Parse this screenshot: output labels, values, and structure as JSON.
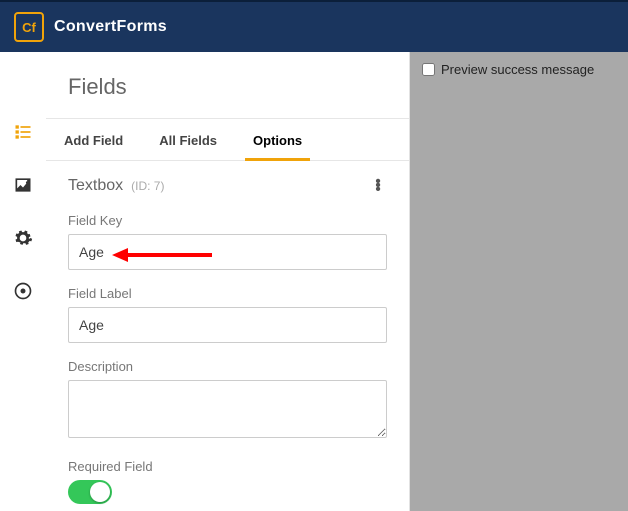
{
  "brand": "ConvertForms",
  "logo_text": "Cf",
  "panel_title": "Fields",
  "tabs": [
    "Add Field",
    "All Fields",
    "Options"
  ],
  "active_tab_index": 2,
  "field_type": "Textbox",
  "field_id": "(ID: 7)",
  "labels": {
    "field_key": "Field Key",
    "field_label": "Field Label",
    "description": "Description",
    "required": "Required Field"
  },
  "values": {
    "field_key": "Age",
    "field_label": "Age",
    "description": ""
  },
  "required_on": true,
  "preview_label": "Preview success message"
}
